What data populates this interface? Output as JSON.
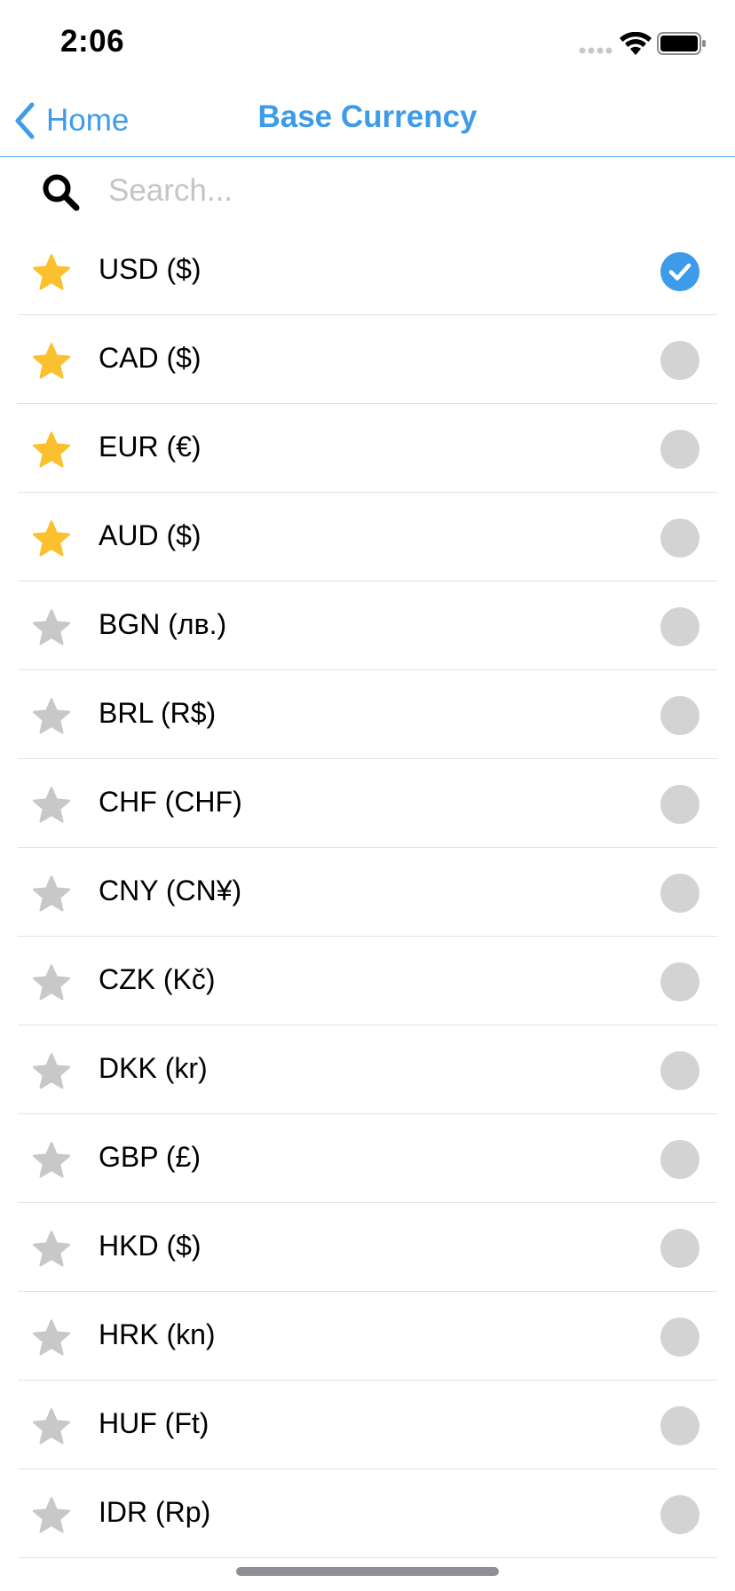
{
  "status_bar": {
    "time": "2:06",
    "signal_icon": "signal-dots-icon",
    "wifi_icon": "wifi-icon",
    "battery_icon": "battery-icon"
  },
  "nav": {
    "back_label": "Home",
    "title": "Base Currency"
  },
  "search": {
    "placeholder": "Search...",
    "value": ""
  },
  "colors": {
    "accent": "#3d9be9",
    "star_favorite": "#fbc02d",
    "star_default": "#c8c8c8",
    "indicator_unselected": "#d3d3d3"
  },
  "currencies": [
    {
      "label": "USD ($)",
      "favorite": true,
      "selected": true
    },
    {
      "label": "CAD ($)",
      "favorite": true,
      "selected": false
    },
    {
      "label": "EUR (€)",
      "favorite": true,
      "selected": false
    },
    {
      "label": "AUD ($)",
      "favorite": true,
      "selected": false
    },
    {
      "label": "BGN (лв.)",
      "favorite": false,
      "selected": false
    },
    {
      "label": "BRL (R$)",
      "favorite": false,
      "selected": false
    },
    {
      "label": "CHF (CHF)",
      "favorite": false,
      "selected": false
    },
    {
      "label": "CNY (CN¥)",
      "favorite": false,
      "selected": false
    },
    {
      "label": "CZK (Kč)",
      "favorite": false,
      "selected": false
    },
    {
      "label": "DKK (kr)",
      "favorite": false,
      "selected": false
    },
    {
      "label": "GBP (£)",
      "favorite": false,
      "selected": false
    },
    {
      "label": "HKD ($)",
      "favorite": false,
      "selected": false
    },
    {
      "label": "HRK (kn)",
      "favorite": false,
      "selected": false
    },
    {
      "label": "HUF (Ft)",
      "favorite": false,
      "selected": false
    },
    {
      "label": "IDR (Rp)",
      "favorite": false,
      "selected": false
    }
  ]
}
